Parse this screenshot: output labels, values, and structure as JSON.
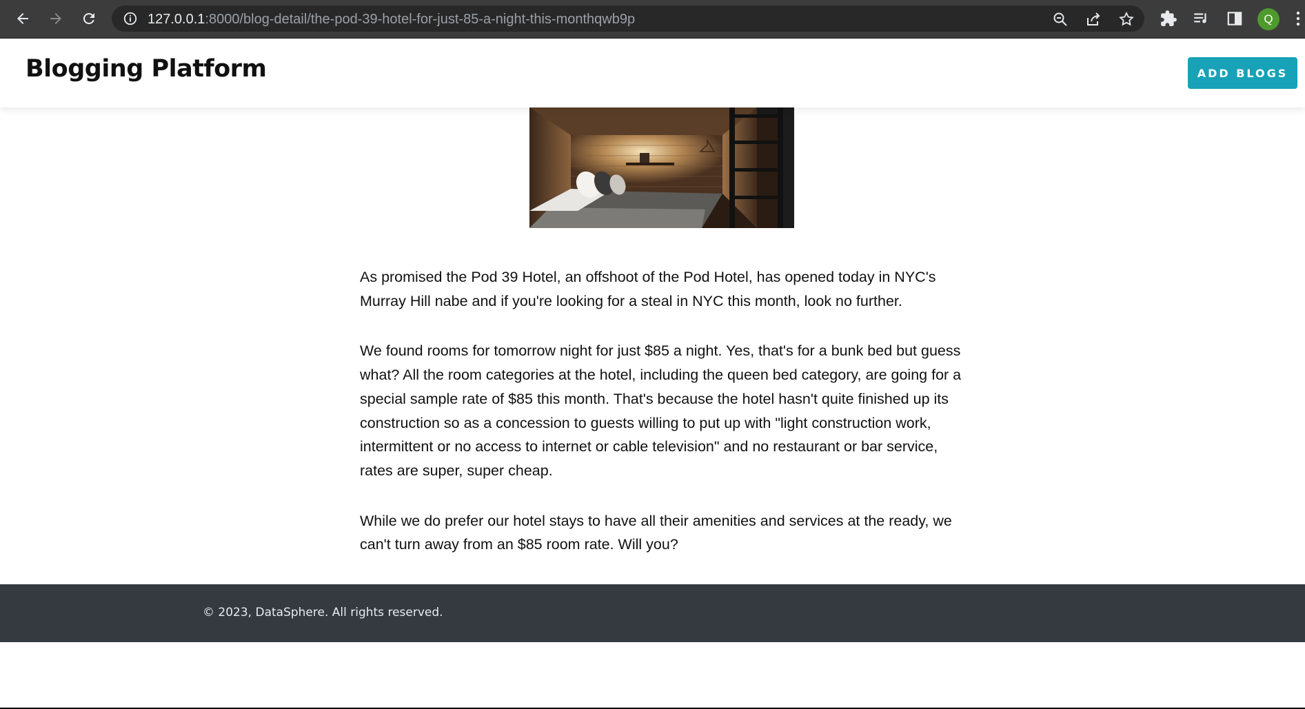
{
  "browser": {
    "url_host": "127.0.0.1",
    "url_path": ":8000/blog-detail/the-pod-39-hotel-for-just-85-a-night-this-monthqwb9p",
    "avatar_letter": "Q",
    "icons": [
      "back-arrow-icon",
      "forward-arrow-icon",
      "reload-icon",
      "info-icon",
      "zoom-icon",
      "share-icon",
      "star-icon",
      "extensions-icon",
      "reading-list-icon",
      "side-panel-icon",
      "menu-kebab-icon"
    ],
    "accent_color": "#4e9a2d"
  },
  "header": {
    "brand": "Blogging Platform",
    "add_button_label": "ADD BLOGS",
    "accent_color": "#17a2b8"
  },
  "article": {
    "paragraphs": [
      "As promised the Pod 39 Hotel, an offshoot of the Pod Hotel, has opened today in NYC's Murray Hill nabe and if you're looking for a steal in NYC this month, look no further.",
      "We found rooms for tomorrow night for just $85 a night. Yes, that's for a bunk bed but guess what? All the room categories at the hotel, including the queen bed category, are going for a special sample rate of $85 this month. That's because the hotel hasn't quite finished up its construction so as a concession to guests willing to put up with \"light construction work, intermittent or no access to internet or cable television\" and no restaurant or bar service, rates are super, super cheap.",
      "While we do prefer our hotel stays to have all their amenities and services at the ready, we can't turn away from an $85 room rate. Will you?"
    ]
  },
  "footer": {
    "copyright": "© 2023, DataSphere. All rights reserved.",
    "background_color": "#343a40"
  }
}
